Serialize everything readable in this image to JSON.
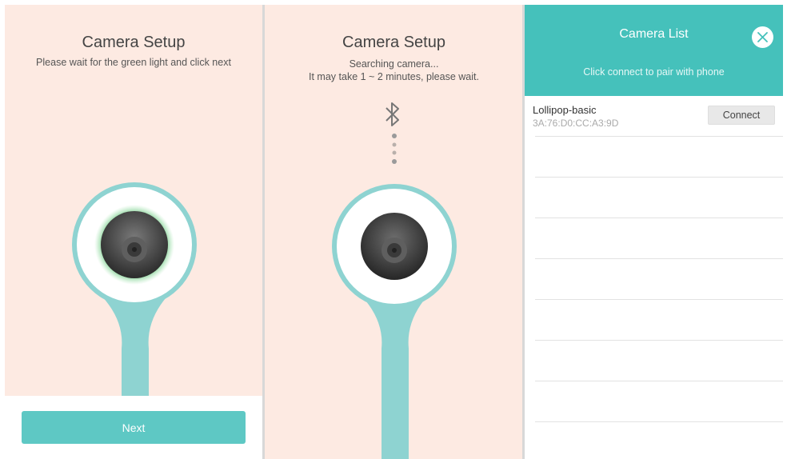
{
  "setup_step1": {
    "title": "Camera Setup",
    "subtitle": "Please wait for the green light and click next",
    "next_label": "Next"
  },
  "setup_step2": {
    "title": "Camera Setup",
    "line1": "Searching camera...",
    "line2": "It may take 1 ~ 2 minutes, please wait."
  },
  "camera_list": {
    "title": "Camera List",
    "subtitle": "Click connect to pair with phone",
    "devices": [
      {
        "name": "Lollipop-basic",
        "mac": "3A:76:D0:CC:A3:9D",
        "button": "Connect"
      }
    ]
  },
  "colors": {
    "panel_bg": "#fdeae2",
    "accent_teal": "#45c1bb",
    "button_teal": "#5ec8c4",
    "camera_body": "#8ed3d1",
    "indicator_green": "#2ea84a"
  },
  "icons": [
    "bluetooth-icon",
    "close-icon"
  ]
}
